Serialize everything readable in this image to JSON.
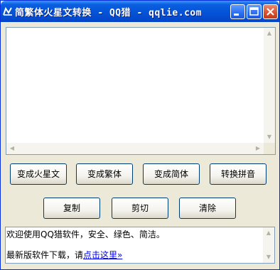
{
  "window": {
    "title": "简繁体火星文转换 - QQ猎 - qqlie.com",
    "minimize_icon": "minimize-icon",
    "maximize_icon": "maximize-icon",
    "close_icon": "close-icon"
  },
  "input": {
    "value": ""
  },
  "row1": {
    "mars_label": "变成火星文",
    "traditional_label": "变成繁体",
    "simplified_label": "变成简体",
    "pinyin_label": "转换拼音"
  },
  "row2": {
    "copy_label": "复制",
    "cut_label": "剪切",
    "clear_label": "清除"
  },
  "message": {
    "welcome": "欢迎使用QQ猎软件，安全、绿色、简洁。",
    "download_prefix": "最新版软件下载，请",
    "download_link": "点击这里»"
  },
  "colors": {
    "title_bar": "#0a5fe0",
    "close_button": "#d6502f",
    "link": "#0000ee",
    "window_bg": "#ece9d8"
  }
}
